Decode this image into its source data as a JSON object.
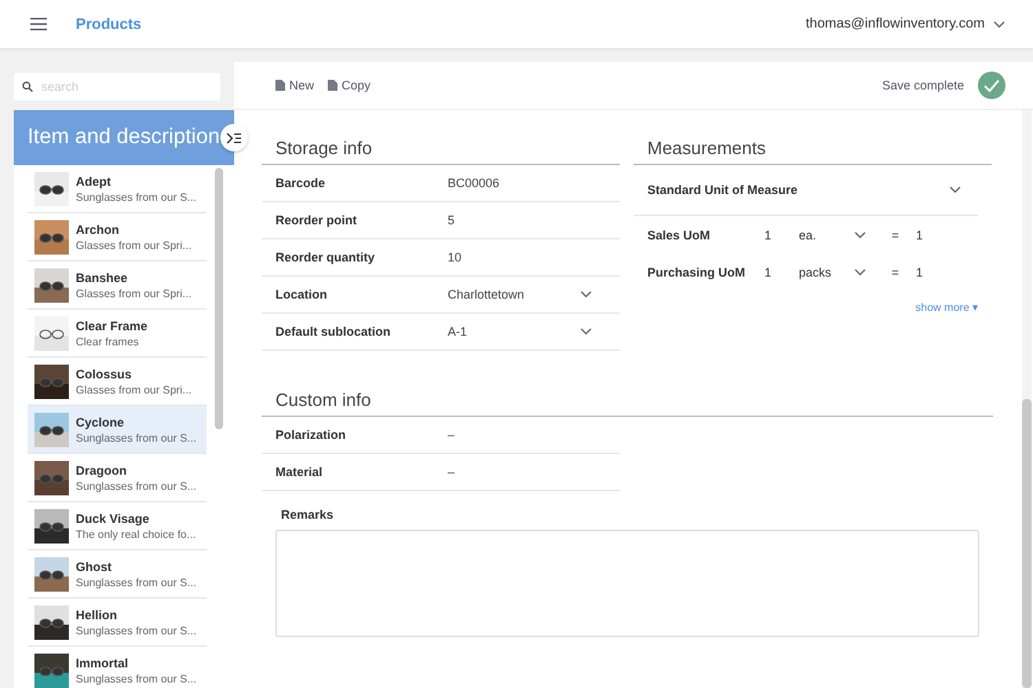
{
  "app_bar": {
    "title": "Products",
    "user": "thomas@inflowinventory.com"
  },
  "sidebar": {
    "search": {
      "placeholder": "search"
    },
    "header": "Item and description",
    "items": [
      {
        "name": "Adept",
        "description": "Sunglasses from our S...",
        "selected": false
      },
      {
        "name": "Archon",
        "description": "Glasses from our Spri...",
        "selected": false
      },
      {
        "name": "Banshee",
        "description": "Glasses from our Spri...",
        "selected": false
      },
      {
        "name": "Clear Frame",
        "description": "Clear frames",
        "selected": false
      },
      {
        "name": "Colossus",
        "description": "Glasses from our Spri...",
        "selected": false
      },
      {
        "name": "Cyclone",
        "description": "Sunglasses from our S...",
        "selected": true
      },
      {
        "name": "Dragoon",
        "description": "Sunglasses from our S...",
        "selected": false
      },
      {
        "name": "Duck Visage",
        "description": "The only real choice fo...",
        "selected": false
      },
      {
        "name": "Ghost",
        "description": "Sunglasses from our S...",
        "selected": false
      },
      {
        "name": "Hellion",
        "description": "Sunglasses from our S...",
        "selected": false
      },
      {
        "name": "Immortal",
        "description": "Sunglasses from our S...",
        "selected": false
      }
    ]
  },
  "toolbar": {
    "buttons": [
      "New",
      "Copy"
    ],
    "status": "Save complete"
  },
  "storage_info": {
    "title": "Storage info",
    "rows": [
      {
        "label": "Barcode",
        "value": "BC00006",
        "kind": "text"
      },
      {
        "label": "Reorder point",
        "value": "5",
        "kind": "text"
      },
      {
        "label": "Reorder quantity",
        "value": "10",
        "kind": "text"
      },
      {
        "label": "Location",
        "value": "Charlottetown",
        "kind": "select"
      },
      {
        "label": "Default sublocation",
        "value": "A-1",
        "kind": "select"
      }
    ]
  },
  "measurements": {
    "title": "Measurements",
    "standard": "Standard Unit of Measure",
    "rows": [
      {
        "label": "Sales UoM",
        "quantity": "1",
        "unit": "ea.",
        "equals": "=",
        "base": "1"
      },
      {
        "label": "Purchasing UoM",
        "quantity": "1",
        "unit": "packs",
        "equals": "=",
        "base": "1"
      }
    ],
    "show_more": "show more ▾"
  },
  "custom_info": {
    "title": "Custom info",
    "rows": [
      {
        "label": "Polarization",
        "value": "–"
      },
      {
        "label": "Material",
        "value": "–"
      }
    ],
    "remarks": {
      "label": "Remarks"
    }
  }
}
